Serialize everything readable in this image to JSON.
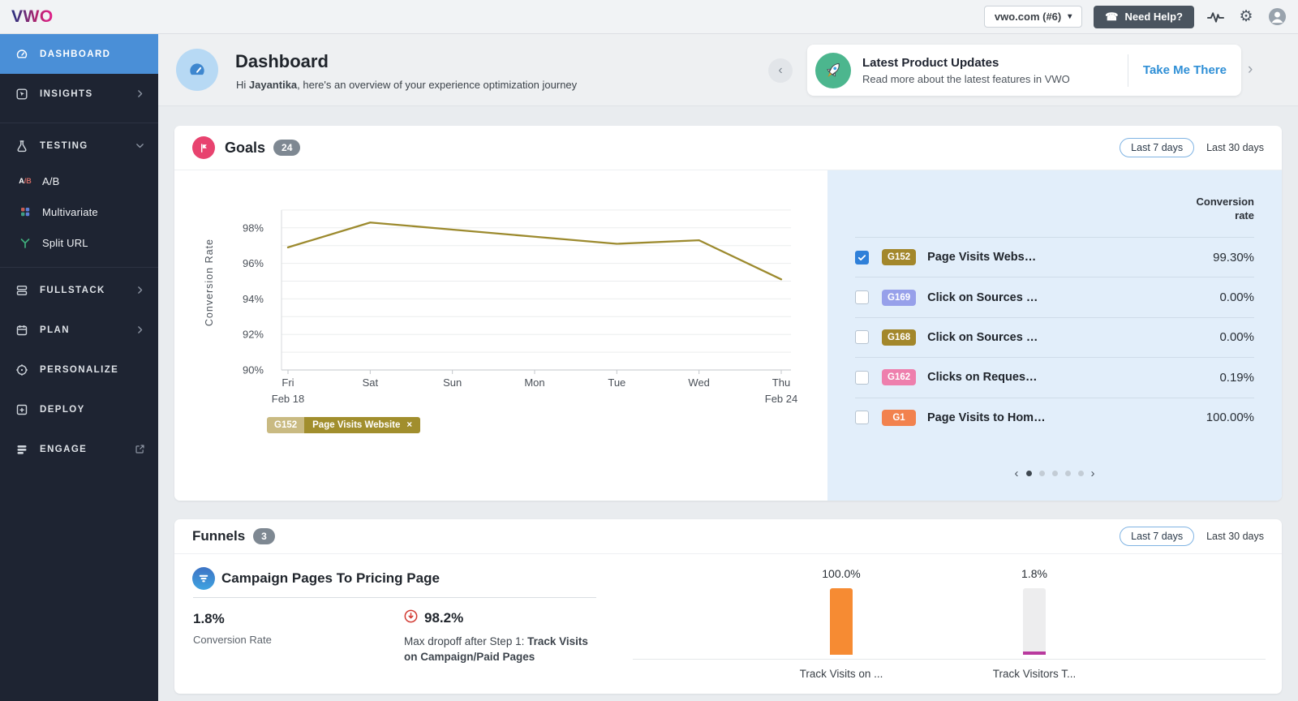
{
  "glyphs": {
    "caret_down": "▾",
    "chevron_left": "‹",
    "chevron_right": "›",
    "arrow_right_small": "▸",
    "close": "×",
    "phone": "☎",
    "gear": "⚙"
  },
  "topbar": {
    "logo": "VWO",
    "account_selector": "vwo.com (#6)",
    "need_help_label": "Need Help?"
  },
  "sidebar": {
    "items": [
      {
        "label": "DASHBOARD",
        "icon": "dashboard",
        "active": true
      },
      {
        "label": "INSIGHTS",
        "icon": "insights",
        "chevron": "right"
      },
      {
        "divider": true
      },
      {
        "label": "TESTING",
        "icon": "testing",
        "chevron": "down"
      },
      {
        "label": "A/B",
        "icon": "ab",
        "sub": true
      },
      {
        "label": "Multivariate",
        "icon": "multivariate",
        "sub": true
      },
      {
        "label": "Split URL",
        "icon": "split-url",
        "sub": true
      },
      {
        "divider": true
      },
      {
        "label": "FULLSTACK",
        "icon": "fullstack",
        "chevron": "right"
      },
      {
        "label": "PLAN",
        "icon": "plan",
        "chevron": "right"
      },
      {
        "label": "PERSONALIZE",
        "icon": "personalize"
      },
      {
        "label": "DEPLOY",
        "icon": "deploy"
      },
      {
        "label": "ENGAGE",
        "icon": "engage",
        "external": true
      }
    ]
  },
  "header": {
    "title": "Dashboard",
    "greeting_prefix": "Hi ",
    "user_name": "Jayantika",
    "greeting_suffix": ", here's an overview of your experience optimization journey"
  },
  "banner": {
    "title": "Latest Product Updates",
    "subtitle": "Read more about the latest features in VWO",
    "cta": "Take Me There"
  },
  "goals": {
    "title": "Goals",
    "count": "24",
    "range_selected": "Last 7 days",
    "range_other": "Last 30 days",
    "table_header_line1": "Conversion",
    "table_header_line2": "rate",
    "rows": [
      {
        "id": "G152",
        "id_color": "#a3872b",
        "label": "Page Visits Webs…",
        "value": "99.30%",
        "checked": true
      },
      {
        "id": "G169",
        "id_color": "#97a0ea",
        "label": "Click on Sources …",
        "value": "0.00%",
        "checked": false
      },
      {
        "id": "G168",
        "id_color": "#a3872b",
        "label": "Click on Sources …",
        "value": "0.00%",
        "checked": false
      },
      {
        "id": "G162",
        "id_color": "#ee7fad",
        "label": "Clicks on Reques…",
        "value": "0.19%",
        "checked": false
      },
      {
        "id": "G1",
        "id_color": "#f2824e",
        "label": "Page Visits to Hom…",
        "value": "100.00%",
        "checked": false
      }
    ],
    "pagination": {
      "dots": 5,
      "active": 0
    }
  },
  "chart_data": [
    {
      "type": "line",
      "x": [
        "Fri",
        "Sat",
        "Sun",
        "Mon",
        "Tue",
        "Wed",
        "Thu"
      ],
      "x_sublabels": [
        "Feb 18",
        "",
        "",
        "",
        "",
        "",
        "Feb 24"
      ],
      "series": [
        {
          "id": "G152",
          "name": "Page Visits Website",
          "color": "#9c8a2e",
          "values": [
            96.9,
            98.3,
            97.9,
            97.5,
            97.1,
            97.3,
            95.1
          ]
        }
      ],
      "ylabel": "Conversion Rate",
      "yticks": [
        90,
        92,
        94,
        96,
        98
      ],
      "ytick_suffix": "%",
      "ylim": [
        90,
        99
      ],
      "grid": true,
      "legend_position": "bottom-left"
    },
    {
      "type": "bar",
      "title": "Campaign Pages To Pricing Page funnel",
      "categories": [
        "Track Visits on ...",
        "Track Visitors T..."
      ],
      "values": [
        100.0,
        1.8
      ],
      "value_labels": [
        "100.0%",
        "1.8%"
      ],
      "colors": [
        "#f68b33",
        "#b93a9e"
      ],
      "ylim": [
        0,
        100
      ]
    }
  ],
  "funnels": {
    "title": "Funnels",
    "count": "3",
    "range_selected": "Last 7 days",
    "range_other": "Last 30 days",
    "funnel": {
      "name": "Campaign Pages To Pricing Page",
      "conversion_value": "1.8%",
      "conversion_label": "Conversion Rate",
      "dropoff_value": "98.2%",
      "dropoff_text": "Max dropoff after Step 1: ",
      "dropoff_step": "Track Visits on Campaign/Paid Pages"
    }
  }
}
